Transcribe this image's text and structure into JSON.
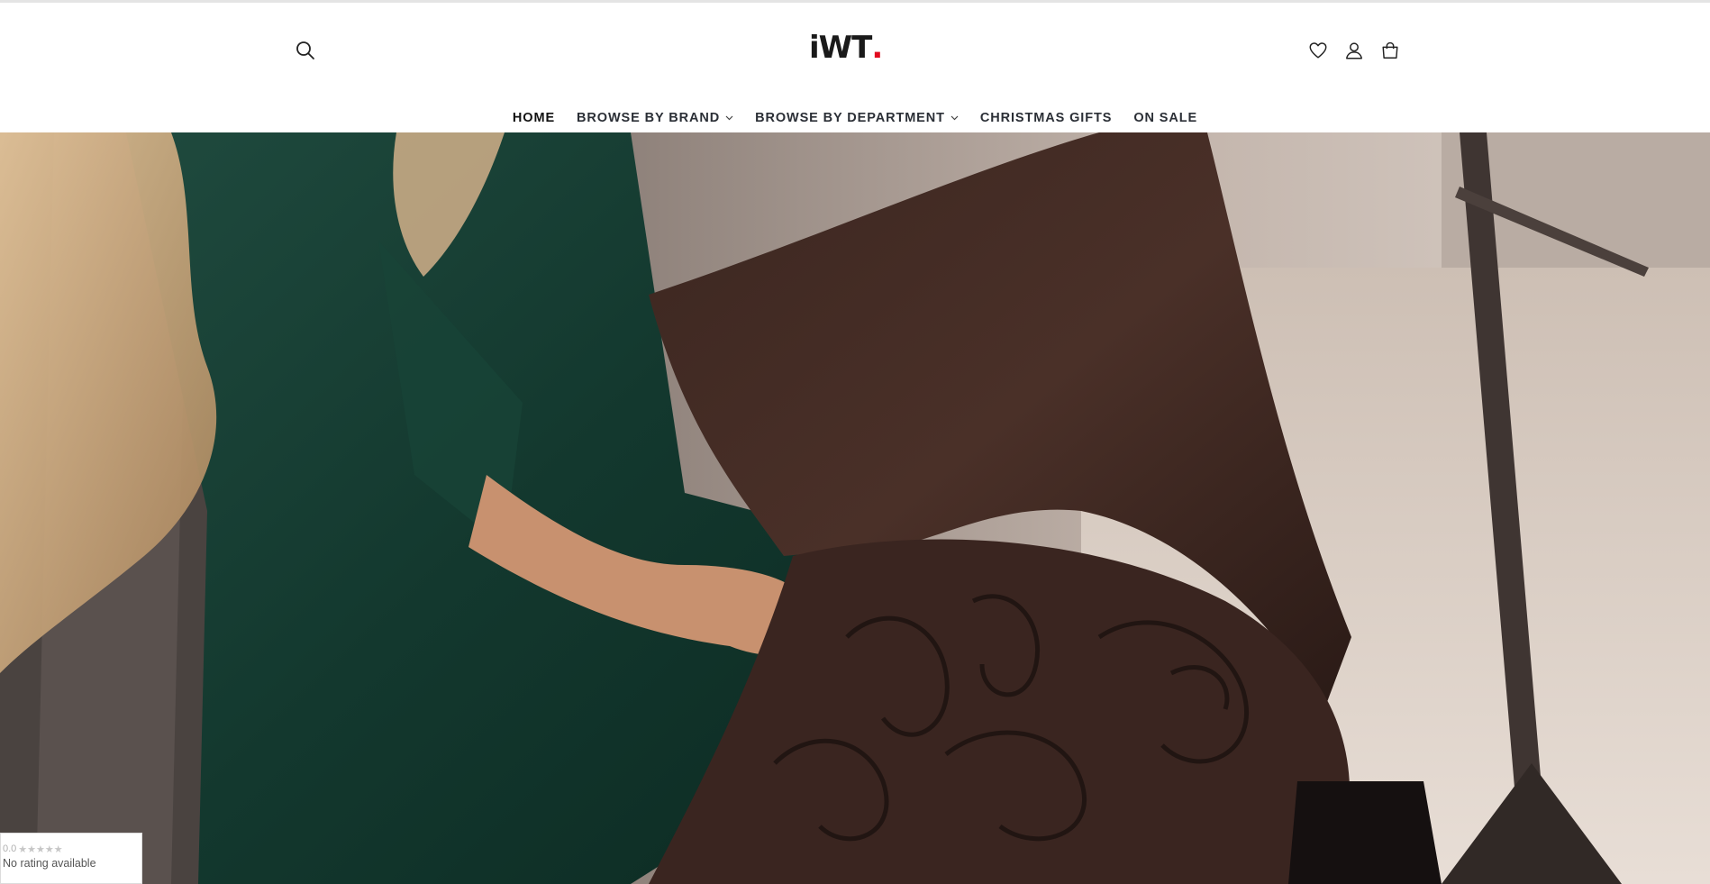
{
  "header": {
    "logo_text": "iWT",
    "logo_dot": ".",
    "brand_color": "#e10b1f",
    "icons": {
      "search": "search-icon",
      "wishlist": "heart-icon",
      "account": "user-icon",
      "cart": "shopping-bag-icon"
    }
  },
  "nav": {
    "items": [
      {
        "label": "HOME",
        "active": true,
        "dropdown": false
      },
      {
        "label": "BROWSE BY BRAND",
        "active": false,
        "dropdown": true
      },
      {
        "label": "BROWSE BY DEPARTMENT",
        "active": false,
        "dropdown": true
      },
      {
        "label": "CHRISTMAS GIFTS",
        "active": false,
        "dropdown": false
      },
      {
        "label": "ON SALE",
        "active": false,
        "dropdown": false
      }
    ]
  },
  "hero": {
    "image_subject": "woman in green dress wearing patterned black tights"
  },
  "rating_widget": {
    "score": "0.0",
    "stars": "★★★★★",
    "text": "No rating available"
  }
}
